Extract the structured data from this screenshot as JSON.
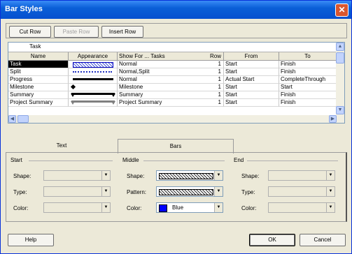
{
  "window": {
    "title": "Bar Styles",
    "close_glyph": "✕"
  },
  "toolbar": {
    "cut_row": "Cut Row",
    "paste_row": "Paste Row",
    "insert_row": "Insert Row"
  },
  "grid": {
    "edit_value": "Task",
    "columns": [
      "Name",
      "Appearance",
      "Show For ... Tasks",
      "Row",
      "From",
      "To"
    ],
    "rows": [
      {
        "name": "Task",
        "show_for": "Normal",
        "row": "1",
        "from": "Start",
        "to": "Finish",
        "selected": true,
        "appearance": "hatch-bar"
      },
      {
        "name": "Split",
        "show_for": "Normal,Split",
        "row": "1",
        "from": "Start",
        "to": "Finish",
        "selected": false,
        "appearance": "dotted-line"
      },
      {
        "name": "Progress",
        "show_for": "Normal",
        "row": "1",
        "from": "Actual Start",
        "to": "CompleteThrough",
        "selected": false,
        "appearance": "solid-thin-bar"
      },
      {
        "name": "Milestone",
        "show_for": "Milestone",
        "row": "1",
        "from": "Start",
        "to": "Start",
        "selected": false,
        "appearance": "diamond"
      },
      {
        "name": "Summary",
        "show_for": "Summary",
        "row": "1",
        "from": "Start",
        "to": "Finish",
        "selected": false,
        "appearance": "summary-bar"
      },
      {
        "name": "Project Summary",
        "show_for": "Project Summary",
        "row": "1",
        "from": "Start",
        "to": "Finish",
        "selected": false,
        "appearance": "project-summary-bar"
      }
    ]
  },
  "tabs": {
    "text": "Text",
    "bars": "Bars"
  },
  "start": {
    "title": "Start",
    "shape_label": "Shape:",
    "type_label": "Type:",
    "color_label": "Color:",
    "shape_value": "",
    "type_value": "",
    "color_value": ""
  },
  "middle": {
    "title": "Middle",
    "shape_label": "Shape:",
    "pattern_label": "Pattern:",
    "color_label": "Color:",
    "color_value": "Blue",
    "color_swatch": "#0000ff"
  },
  "end": {
    "title": "End",
    "shape_label": "Shape:",
    "type_label": "Type:",
    "color_label": "Color:",
    "shape_value": "",
    "type_value": "",
    "color_value": ""
  },
  "footer": {
    "help": "Help",
    "ok": "OK",
    "cancel": "Cancel"
  },
  "colors": {
    "titlebar": "#0a5fd7",
    "dialog_bg": "#ece9d8",
    "selection": "#000000"
  }
}
